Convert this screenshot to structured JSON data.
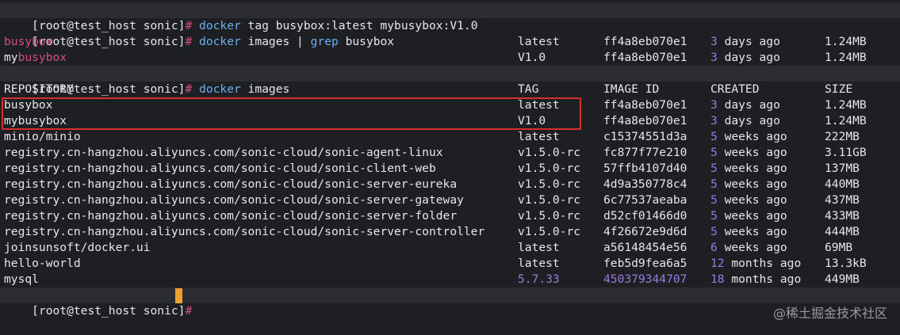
{
  "prompt": "[root@test_host sonic]",
  "hash": "#",
  "commands": {
    "c1_docker": "docker",
    "c1_rest": " tag busybox:latest mybusybox:V1.0",
    "c2_docker": "docker",
    "c2_mid": " images | ",
    "c2_grep": "grep",
    "c2_rest": " busybox",
    "c3_docker": "docker",
    "c3_rest": " images"
  },
  "grep_results": [
    {
      "prefix": "",
      "match": "busybox",
      "tag": "latest",
      "id": "ff4a8eb070e1",
      "created_num": "3",
      "created_rest": " days ago",
      "size": "1.24MB"
    },
    {
      "prefix": "my",
      "match": "busybox",
      "tag": "V1.0",
      "id": "ff4a8eb070e1",
      "created_num": "3",
      "created_rest": " days ago",
      "size": "1.24MB"
    }
  ],
  "headers": {
    "repository": "REPOSITORY",
    "tag": "TAG",
    "image_id": "IMAGE ID",
    "created": "CREATED",
    "size": "SIZE"
  },
  "images": [
    {
      "repo": "busybox",
      "tag": "latest",
      "id": "ff4a8eb070e1",
      "created_num": "3",
      "created_rest": " days ago",
      "size": "1.24MB"
    },
    {
      "repo": "mybusybox",
      "tag": "V1.0",
      "id": "ff4a8eb070e1",
      "created_num": "3",
      "created_rest": " days ago",
      "size": "1.24MB"
    },
    {
      "repo": "minio/minio",
      "tag": "latest",
      "id": "c15374551d3a",
      "created_num": "5",
      "created_rest": " weeks ago",
      "size": "222MB"
    },
    {
      "repo": "registry.cn-hangzhou.aliyuncs.com/sonic-cloud/sonic-agent-linux",
      "tag": "v1.5.0-rc",
      "id": "fc877f77e210",
      "created_num": "5",
      "created_rest": " weeks ago",
      "size": "3.11GB"
    },
    {
      "repo": "registry.cn-hangzhou.aliyuncs.com/sonic-cloud/sonic-client-web",
      "tag": "v1.5.0-rc",
      "id": "57ffb4107d40",
      "created_num": "5",
      "created_rest": " weeks ago",
      "size": "137MB"
    },
    {
      "repo": "registry.cn-hangzhou.aliyuncs.com/sonic-cloud/sonic-server-eureka",
      "tag": "v1.5.0-rc",
      "id": "4d9a350778c4",
      "created_num": "5",
      "created_rest": " weeks ago",
      "size": "440MB"
    },
    {
      "repo": "registry.cn-hangzhou.aliyuncs.com/sonic-cloud/sonic-server-gateway",
      "tag": "v1.5.0-rc",
      "id": "6c77537aeaba",
      "created_num": "5",
      "created_rest": " weeks ago",
      "size": "437MB"
    },
    {
      "repo": "registry.cn-hangzhou.aliyuncs.com/sonic-cloud/sonic-server-folder",
      "tag": "v1.5.0-rc",
      "id": "d52cf01466d0",
      "created_num": "5",
      "created_rest": " weeks ago",
      "size": "433MB"
    },
    {
      "repo": "registry.cn-hangzhou.aliyuncs.com/sonic-cloud/sonic-server-controller",
      "tag": "v1.5.0-rc",
      "id": "4f26672e9d6d",
      "created_num": "5",
      "created_rest": " weeks ago",
      "size": "444MB"
    },
    {
      "repo": "joinsunsoft/docker.ui",
      "tag": "latest",
      "id": "a56148454e56",
      "created_num": "6",
      "created_rest": " weeks ago",
      "size": "69MB"
    },
    {
      "repo": "hello-world",
      "tag": "latest",
      "id": "feb5d9fea6a5",
      "created_num": "12",
      "created_rest": " months ago",
      "size": "13.3kB"
    },
    {
      "repo": "mysql",
      "tag": "5.7.33",
      "id": "450379344707",
      "created_num": "18",
      "created_rest": " months ago",
      "size": "449MB"
    }
  ],
  "watermark": "@稀土掘金技术社区",
  "colors": {
    "background": "#1e1f22",
    "command": "#6ab0f3",
    "hash": "#d1507a",
    "number": "#9b7be0",
    "highlight_box": "#d4302c",
    "cursor": "#f0a030"
  }
}
